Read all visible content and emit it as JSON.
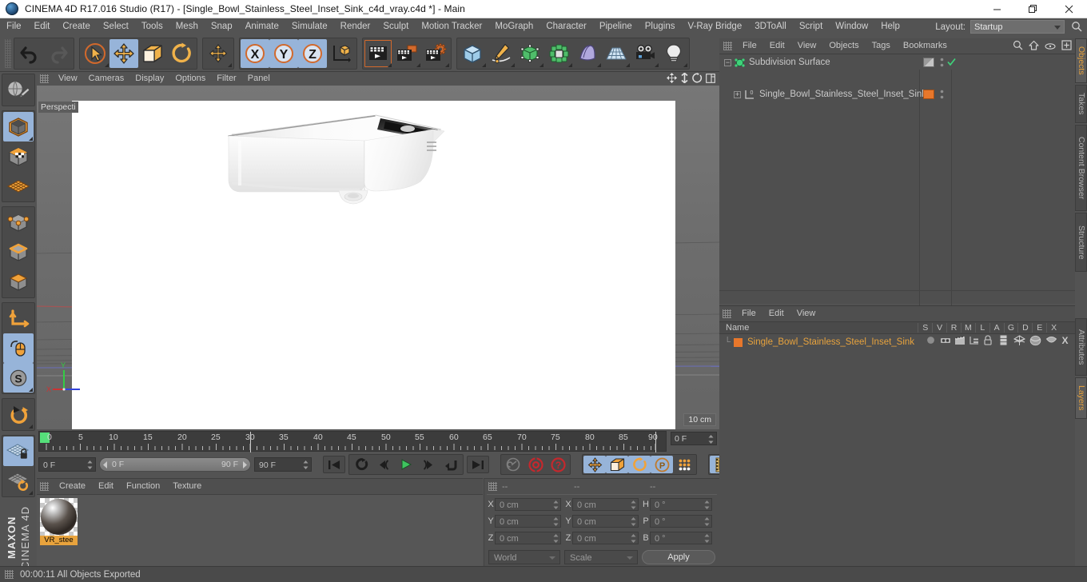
{
  "window": {
    "title": "CINEMA 4D R17.016 Studio (R17) - [Single_Bowl_Stainless_Steel_Inset_Sink_c4d_vray.c4d *] - Main",
    "app_icon": "c4d-logo-icon",
    "minimize": "minimize-icon",
    "maximize": "restore-icon",
    "close": "close-icon"
  },
  "menubar": {
    "items": [
      "File",
      "Edit",
      "Create",
      "Select",
      "Tools",
      "Mesh",
      "Snap",
      "Animate",
      "Simulate",
      "Render",
      "Sculpt",
      "Motion Tracker",
      "MoGraph",
      "Character",
      "Pipeline",
      "Plugins",
      "V-Ray Bridge",
      "3DToAll",
      "Script",
      "Window",
      "Help"
    ],
    "layout_label": "Layout:",
    "layout_value": "Startup",
    "search_icon": "search-icon"
  },
  "toolbar": {
    "groups": [
      {
        "name": "undo-redo",
        "buttons": [
          {
            "icon": "undo-icon",
            "label": "Undo",
            "active": false
          },
          {
            "icon": "redo-icon",
            "label": "Redo",
            "active": false,
            "disabled": true
          }
        ]
      },
      {
        "name": "selection-tools",
        "buttons": [
          {
            "icon": "live-selection-icon",
            "label": "Live Selection",
            "active": false,
            "corner": true
          },
          {
            "icon": "move-icon",
            "label": "Move",
            "active": true
          },
          {
            "icon": "scale-icon",
            "label": "Scale",
            "active": false
          },
          {
            "icon": "rotate-icon",
            "label": "Rotate",
            "active": false
          }
        ]
      },
      {
        "name": "world-object-axis",
        "buttons": [
          {
            "icon": "world-axis-icon",
            "label": "World / Object Axis",
            "active": false,
            "corner": true
          }
        ]
      },
      {
        "name": "axis-locks",
        "buttons": [
          {
            "icon": "x-axis-icon",
            "label": "X Axis Lock",
            "active": true
          },
          {
            "icon": "y-axis-icon",
            "label": "Y Axis Lock",
            "active": true
          },
          {
            "icon": "z-axis-icon",
            "label": "Z Axis Lock",
            "active": true
          },
          {
            "icon": "coordinate-system-icon",
            "label": "Coordinate System",
            "active": false
          }
        ]
      },
      {
        "name": "render-tools",
        "buttons": [
          {
            "icon": "render-view-icon",
            "label": "Render View",
            "active": false,
            "corner": true
          },
          {
            "icon": "render-region-icon",
            "label": "Render to Picture Viewer",
            "active": false,
            "corner": true
          },
          {
            "icon": "render-settings-icon",
            "label": "Edit Render Settings",
            "active": false,
            "corner": true
          }
        ]
      },
      {
        "name": "object-creation",
        "buttons": [
          {
            "icon": "cube-primitive-icon",
            "label": "Add Cube Object",
            "active": false,
            "corner": true
          },
          {
            "icon": "spline-pen-icon",
            "label": "Add Spline",
            "active": false,
            "corner": true
          },
          {
            "icon": "nurbs-icon",
            "label": "Add NURBS Object",
            "active": false,
            "corner": true
          },
          {
            "icon": "array-icon",
            "label": "Add Modeling Object",
            "active": false,
            "corner": true
          },
          {
            "icon": "deformer-icon",
            "label": "Add Deformer Object",
            "active": false,
            "corner": true
          },
          {
            "icon": "scene-floor-icon",
            "label": "Add Scene Object",
            "active": false,
            "corner": true
          },
          {
            "icon": "camera-icon",
            "label": "Add Camera Object",
            "active": false,
            "corner": true
          },
          {
            "icon": "light-icon",
            "label": "Add Light Object",
            "active": false,
            "corner": true
          }
        ]
      }
    ]
  },
  "left_toolbar": {
    "groups": [
      {
        "buttons": [
          {
            "icon": "make-editable-icon",
            "label": "Make Editable",
            "active": false
          }
        ]
      },
      {
        "buttons": [
          {
            "icon": "model-mode-icon",
            "label": "Model Mode",
            "active": true,
            "corner": true
          },
          {
            "icon": "texture-mode-icon",
            "label": "Texture Mode",
            "active": false
          },
          {
            "icon": "workplane-mode-icon",
            "label": "Workplane Mode",
            "active": false
          }
        ]
      },
      {
        "buttons": [
          {
            "icon": "points-mode-icon",
            "label": "Points Mode",
            "active": false
          },
          {
            "icon": "edges-mode-icon",
            "label": "Edges Mode",
            "active": false
          },
          {
            "icon": "polygons-mode-icon",
            "label": "Polygons Mode",
            "active": false
          }
        ]
      },
      {
        "buttons": [
          {
            "icon": "object-axis-icon",
            "label": "Enable Axis Modification",
            "active": false
          },
          {
            "icon": "viewport-solo-icon",
            "label": "Enable Snapping",
            "active": true
          },
          {
            "icon": "snap-icon",
            "label": "Snap Settings",
            "active": true,
            "corner": true
          }
        ]
      },
      {
        "buttons": [
          {
            "icon": "undo-view-icon",
            "label": "Undo View",
            "active": false,
            "corner": true
          }
        ]
      },
      {
        "buttons": [
          {
            "icon": "lock-workplane-icon",
            "label": "Lock Workplane",
            "active": true
          },
          {
            "icon": "planar-workplane-icon",
            "label": "Planar Workplane",
            "active": false,
            "corner": true
          }
        ]
      }
    ],
    "brand_line1": "MAXON",
    "brand_line2": "CINEMA 4D"
  },
  "viewport": {
    "menu": [
      "View",
      "Cameras",
      "Display",
      "Options",
      "Filter",
      "Panel"
    ],
    "panel_icons": [
      "pan-view-icon",
      "zoom-view-icon",
      "rotate-view-icon",
      "maximize-view-icon"
    ],
    "perspective_label": "Perspecti",
    "scale_label": "10 cm",
    "axis": {
      "x": "X",
      "y": "Y",
      "z": "Z",
      "x_color": "#cc3333",
      "y_color": "#33cc44",
      "z_color": "#3344dd"
    },
    "model_name": "Single Bowl Stainless Steel Inset Sink"
  },
  "timeline": {
    "ticks": [
      "0",
      "5",
      "10",
      "15",
      "20",
      "25",
      "30",
      "35",
      "40",
      "45",
      "50",
      "55",
      "60",
      "65",
      "70",
      "75",
      "80",
      "85",
      "90"
    ],
    "current_frame_right": "0 F",
    "current_frame": "0 F",
    "range_start": "0 F",
    "range_end": "90 F",
    "max_frame": "90 F",
    "transport": [
      {
        "icon": "go-to-start-icon",
        "label": "Go To Start"
      },
      {
        "icon": "loop-icon",
        "label": "Play Mode"
      },
      {
        "icon": "step-back-icon",
        "label": "Go To Previous Frame"
      },
      {
        "icon": "play-icon",
        "label": "Play Forwards"
      },
      {
        "icon": "step-forward-icon",
        "label": "Go To Next Frame"
      },
      {
        "icon": "return-icon",
        "label": "Play Mode Loop"
      },
      {
        "icon": "go-to-end-icon",
        "label": "Go To End"
      }
    ],
    "record_tools": [
      {
        "icon": "keyframe-key-icon",
        "label": "Autokeying"
      },
      {
        "icon": "record-active-objects-icon",
        "label": "Record Active Objects"
      },
      {
        "icon": "keyframe-selection-icon",
        "label": "Keyframe Selection"
      }
    ],
    "param_toggles": [
      {
        "icon": "position-key-icon",
        "label": "Position",
        "active": true
      },
      {
        "icon": "scale-key-icon",
        "label": "Scale",
        "active": true
      },
      {
        "icon": "rotation-key-icon",
        "label": "Rotation",
        "active": true
      },
      {
        "icon": "pla-key-icon",
        "label": "Point Level Animation",
        "active": true
      },
      {
        "icon": "parameter-key-icon",
        "label": "Animation Parameters",
        "active": false
      }
    ],
    "filmstrip": {
      "icon": "timeline-icon",
      "label": "Timeline",
      "active": true
    }
  },
  "material_manager": {
    "menu": [
      "Create",
      "Edit",
      "Function",
      "Texture"
    ],
    "materials": [
      {
        "name": "VR_stee",
        "preview": "metal-sphere-preview",
        "selected": true
      }
    ]
  },
  "coordinates": {
    "header_cols": [
      "--",
      "--",
      "--"
    ],
    "rows": [
      {
        "label1": "X",
        "value1": "0 cm",
        "label2": "X",
        "value2": "0 cm",
        "label3": "H",
        "value3": "0 °"
      },
      {
        "label1": "Y",
        "value1": "0 cm",
        "label2": "Y",
        "value2": "0 cm",
        "label3": "P",
        "value3": "0 °"
      },
      {
        "label1": "Z",
        "value1": "0 cm",
        "label2": "Z",
        "value2": "0 cm",
        "label3": "B",
        "value3": "0 °"
      }
    ],
    "system": "World",
    "mode": "Scale",
    "apply": "Apply"
  },
  "object_manager": {
    "menu": [
      "File",
      "Edit",
      "View",
      "Objects",
      "Tags",
      "Bookmarks"
    ],
    "header_icons": [
      "search-icon",
      "home-icon",
      "eye-icon",
      "new-layer-icon"
    ],
    "objects": [
      {
        "name": "Subdivision Surface",
        "icon": "subdivision-surface-icon",
        "indent": 0,
        "tag_color": "#8c8c8c",
        "has_check": true
      },
      {
        "name": "Single_Bowl_Stainless_Steel_Inset_Sink",
        "icon": "polygon-object-icon",
        "indent": 1,
        "tag_color": "#e8772b",
        "has_check": false
      }
    ]
  },
  "layer_manager": {
    "menu": [
      "File",
      "Edit",
      "View"
    ],
    "name_col": "Name",
    "columns": [
      "S",
      "V",
      "R",
      "M",
      "L",
      "A",
      "G",
      "D",
      "E",
      "X"
    ],
    "rows": [
      {
        "name": "Single_Bowl_Stainless_Steel_Inset_Sink",
        "color": "#e8772b",
        "icons": [
          "solo-dot-icon",
          "visible-eye-icon",
          "render-clapper-icon",
          "manager-icon",
          "lock-icon",
          "animation-icon",
          "generator-icon",
          "deformer-icon",
          "expression-icon",
          "xref-icon"
        ]
      }
    ]
  },
  "right_tabs": {
    "top": [
      {
        "label": "Objects",
        "selected": true
      },
      {
        "label": "Takes",
        "selected": false
      },
      {
        "label": "Content Browser",
        "selected": false
      },
      {
        "label": "Structure",
        "selected": false
      }
    ],
    "bottom": [
      {
        "label": "Attributes",
        "selected": false
      },
      {
        "label": "Layers",
        "selected": true
      }
    ]
  },
  "statusbar": {
    "text": "00:00:11 All Objects Exported"
  },
  "colors": {
    "accent_orange": "#e8a33d",
    "tag_orange": "#e8772b",
    "active_blue": "#97b4d9",
    "panel_bg": "#4f4f4f",
    "chrome_bg": "#535353",
    "viewport_bg": "#6b6b6b",
    "green_play": "#3ec45e"
  }
}
